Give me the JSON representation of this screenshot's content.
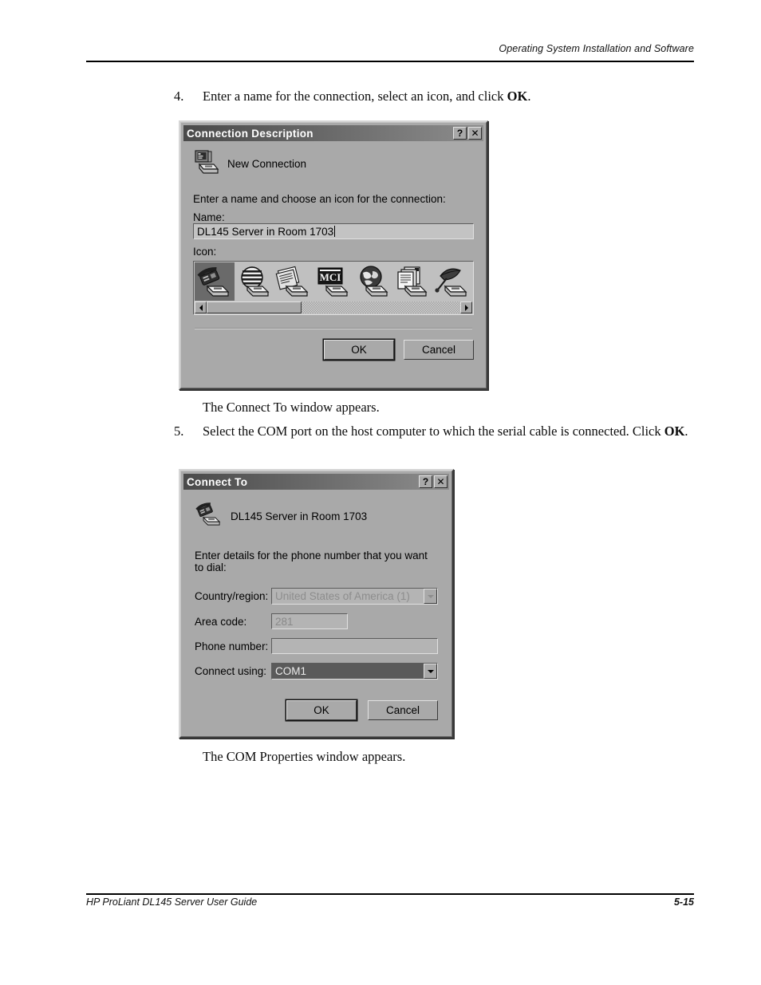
{
  "page": {
    "header_title": "Operating System Installation and Software",
    "footer_title": "HP ProLiant DL145 Server User Guide",
    "footer_page": "5-15"
  },
  "content": {
    "step4": {
      "number": "4.",
      "text_before": "Enter a name for the connection, select an icon, and click ",
      "bold": "OK",
      "text_after": "."
    },
    "caption1": "The Connect To window appears.",
    "step5": {
      "number": "5.",
      "text_before": "Select the COM port on the host computer to which the serial cable is connected. Click ",
      "bold": "OK",
      "text_after": "."
    },
    "caption2": "The COM Properties window appears."
  },
  "dialog_connection_description": {
    "title": "Connection Description",
    "titlebar_buttons": [
      {
        "name": "help-button",
        "label": "?"
      },
      {
        "name": "close-button",
        "label": "✕"
      }
    ],
    "header_icon": "computer-modem-icon",
    "header_label": "New Connection",
    "prompt": "Enter a name and choose an icon for the connection:",
    "name_label": "Name:",
    "name_value": "DL145 Server in Room 1703",
    "name_placeholder": "",
    "icon_label": "Icon:",
    "icons": [
      {
        "name": "telephone-modem-icon",
        "selected": true
      },
      {
        "name": "striped-globe-modem-icon",
        "selected": false
      },
      {
        "name": "papers-modem-icon",
        "selected": false
      },
      {
        "name": "mci-logo-modem-icon",
        "selected": false,
        "label": "MCI"
      },
      {
        "name": "world-network-modem-icon",
        "selected": false
      },
      {
        "name": "documents-modem-icon",
        "selected": false
      },
      {
        "name": "satellite-dish-modem-icon",
        "selected": false
      }
    ],
    "scrollbar": {
      "left_arrow": "◄",
      "right_arrow": "►"
    },
    "ok_label": "OK",
    "cancel_label": "Cancel"
  },
  "dialog_connect_to": {
    "title": "Connect To",
    "titlebar_buttons": [
      {
        "name": "help-button",
        "label": "?"
      },
      {
        "name": "close-button",
        "label": "✕"
      }
    ],
    "header_icon": "telephone-modem-icon",
    "header_label": "DL145 Server in Room 1703",
    "prompt": "Enter details for the phone number that you want to dial:",
    "fields": [
      {
        "name": "country-region",
        "label": "Country/region:",
        "value": "United States of America (1)",
        "state": "disabled",
        "control": "combo"
      },
      {
        "name": "area-code",
        "label": "Area code:",
        "value": "281",
        "state": "disabled",
        "control": "text"
      },
      {
        "name": "phone-number",
        "label": "Phone number:",
        "value": "",
        "state": "enabled",
        "control": "text"
      },
      {
        "name": "connect-using",
        "label": "Connect using:",
        "value": "COM1",
        "state": "selected",
        "control": "combo"
      }
    ],
    "ok_label": "OK",
    "cancel_label": "Cancel"
  }
}
